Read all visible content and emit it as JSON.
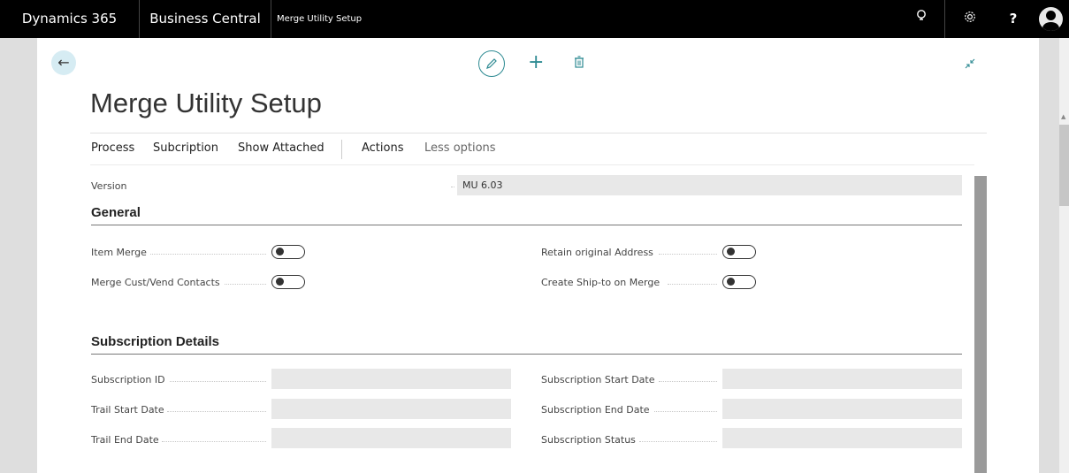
{
  "topbar": {
    "brand": "Dynamics 365",
    "product": "Business Central",
    "breadcrumb": "Merge Utility Setup",
    "lightbulb_icon": "lightbulb-icon",
    "settings_icon": "gear-icon",
    "help_label": "?",
    "avatar_icon": "user-avatar-icon"
  },
  "page": {
    "title": "Merge Utility Setup",
    "back_glyph": "←",
    "plus_glyph": "+"
  },
  "actions": {
    "items": [
      "Process",
      "Subcription",
      "Show Attached",
      "Actions",
      "Less options"
    ]
  },
  "fields": {
    "version_label": "Version",
    "version_value": "MU 6.03"
  },
  "general": {
    "heading": "General",
    "item_merge": "Item Merge",
    "merge_contacts": "Merge Cust/Vend Contacts",
    "retain_address": "Retain original Address",
    "create_shipto": "Create Ship-to on Merge"
  },
  "subscription": {
    "heading": "Subscription Details",
    "id": "Subscription ID",
    "trail_start": "Trail Start Date",
    "trail_end": "Trail End Date",
    "start_date": "Subscription Start Date",
    "end_date": "Subscription End Date",
    "status": "Subscription Status"
  },
  "colors": {
    "accent": "#2d8a92",
    "topbar": "#000000",
    "field_bg": "#e8e8e8"
  }
}
